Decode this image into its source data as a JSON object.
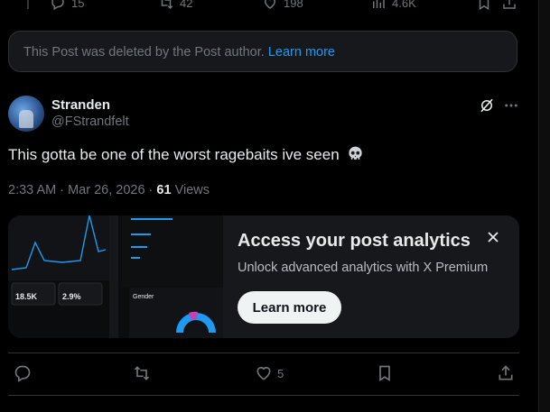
{
  "top_actions": {
    "replies": "15",
    "reposts": "42",
    "likes": "198",
    "views": "4.6K"
  },
  "deleted_notice": {
    "text": "This Post was deleted by the Post author.",
    "link": "Learn more"
  },
  "post": {
    "display_name": "Stranden",
    "handle": "@FStrandfelt",
    "text": "This gotta be one of the worst ragebaits ive seen",
    "emoji_icon": "skull-icon",
    "time": "2:33 AM · Mar 26, 2026 · ",
    "views_count": "61",
    "views_label": " Views"
  },
  "analytics_card": {
    "title": "Access your post analytics",
    "subtitle": "Unlock advanced analytics with X Premium",
    "button": "Learn more",
    "preview": {
      "stat1": "18.5K",
      "stat2": "2.9%",
      "gender_label": "Gender"
    }
  },
  "bottom_actions": {
    "likes": "5"
  },
  "colors": {
    "background": "#000000",
    "link": "#1d9bf0",
    "muted": "#71767b",
    "text": "#e7e9ea"
  }
}
